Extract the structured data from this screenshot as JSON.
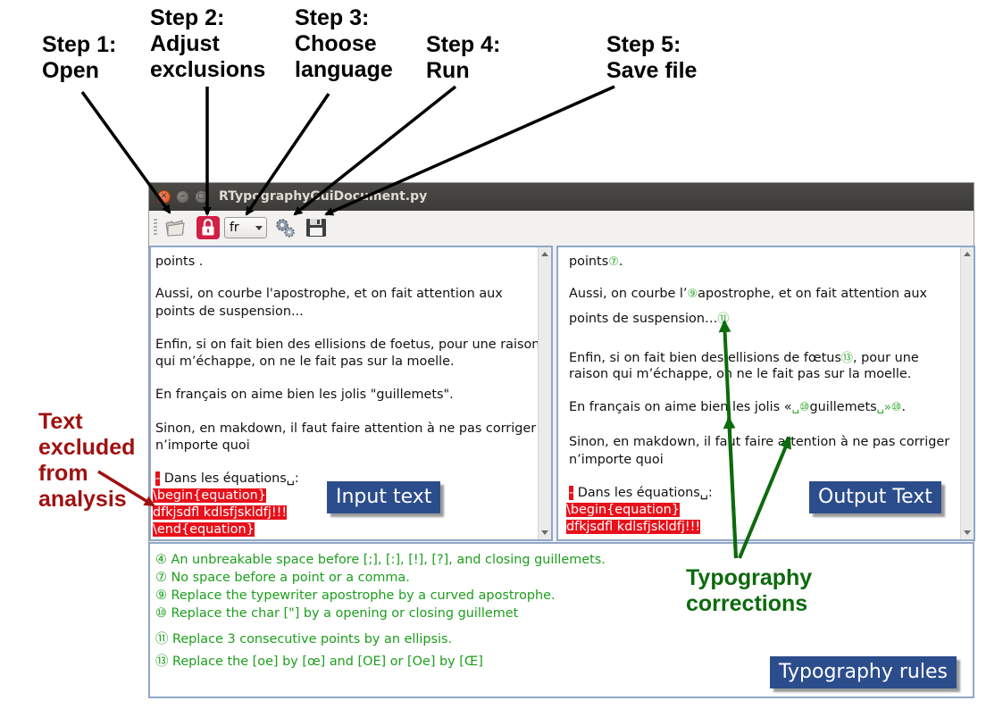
{
  "steps": [
    {
      "line1": "Step 1:",
      "line2": "Open"
    },
    {
      "line1": "Step 2:",
      "line2": "Adjust",
      "line3": "exclusions"
    },
    {
      "line1": "Step 3:",
      "line2": "Choose",
      "line3": "language"
    },
    {
      "line1": "Step 4:",
      "line2": "Run"
    },
    {
      "line1": "Step 5:",
      "line2": "Save file"
    }
  ],
  "labels": {
    "excluded": [
      "Text",
      "excluded",
      "from",
      "analysis"
    ],
    "corrections": [
      "Typography",
      "corrections"
    ]
  },
  "window": {
    "title": "RTypographyGuiDocument.py",
    "language": "fr"
  },
  "input_pane": {
    "tag": "Input text",
    "lines": {
      "l1": "points .",
      "l2": "Aussi, on courbe l'apostrophe, et on fait attention aux",
      "l3": "points de suspension...",
      "l4": "Enfin, si on fait bien des ellisions de foetus, pour une raison",
      "l5": "qui m’échappe, on ne le fait pas sur la moelle.",
      "l6": "En français on aime bien les jolis \"guillemets\".",
      "l7": "Sinon, en makdown, il faut faire attention à ne pas corriger",
      "l8": "n’importe quoi",
      "l9_marker": "-",
      "l9_text": " Dans les équations␣:",
      "l10": "\\begin{equation}",
      "l11": "dfkjsdfl     kdlsfjskldfj!!!",
      "l12": "\\end{equation}"
    }
  },
  "output_pane": {
    "tag": "Output Text",
    "lines": {
      "l1a": "points",
      "l1n": "⑦",
      "l1b": ".",
      "l2a": "Aussi, on courbe l’",
      "l2n": "⑨",
      "l2b": "apostrophe, et on fait attention aux",
      "l3a": "points de suspension…",
      "l3n": "⑪",
      "l4a": "Enfin, si on fait bien des ellisions de fœtus",
      "l4n": "⑬",
      "l4b": ", pour une",
      "l5": "raison qui m’échappe, on ne le fait pas sur la moelle.",
      "l6a": "En français on aime bien les jolis «",
      "l6n1": "␣⑩",
      "l6b": "guillemets",
      "l6n2": "␣»⑩",
      "l6c": ".",
      "l7": "Sinon, en makdown, il faut faire attention à ne pas corriger",
      "l8": "n’importe quoi",
      "l9_marker": "-",
      "l9_text": " Dans les équations␣:",
      "l10": "\\begin{equation}",
      "l11": "dfkjsdfl     kdlsfjskldfj!!!"
    }
  },
  "rules": {
    "tag": "Typography rules",
    "items": [
      "④ An unbreakable space before [;], [:], [!], [?], and closing guillemets.",
      "⑦ No space before a point or a comma.",
      "⑨ Replace the typewriter apostrophe by a curved apostrophe.",
      "⑩ Replace the char [\"] by a opening or closing guillemet",
      "⑪ Replace 3 consecutive points by an ellipsis.",
      "⑬ Replace the [oe] by [œ] and [OE] or [Oe] by [Œ]"
    ]
  },
  "colors": {
    "excluded_label": "#a01010",
    "corrections_label": "#0d6a0d",
    "exclusion_highlight": "#e8101a",
    "rule_text": "#1c9e1c",
    "tag_bg": "#2c4d8c",
    "pane_border": "#8fa7c8"
  },
  "icons": {
    "open": "folder-icon",
    "exclusions": "lock-icon",
    "run": "gears-icon",
    "save": "floppy-disk-icon"
  }
}
